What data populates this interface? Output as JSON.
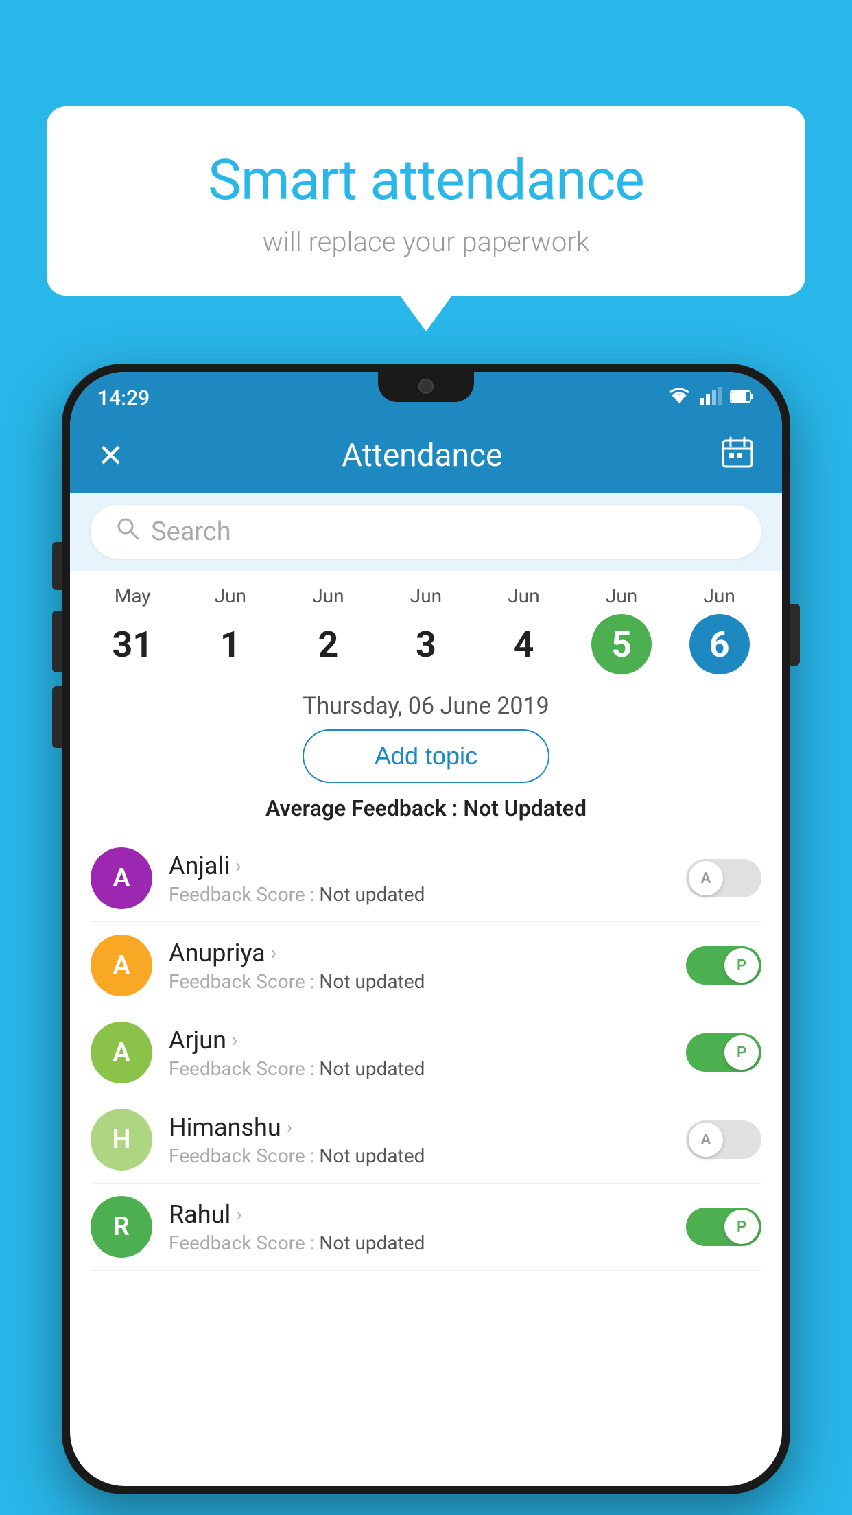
{
  "bubble": {
    "title": "Smart attendance",
    "subtitle": "will replace your paperwork"
  },
  "statusBar": {
    "time": "14:29",
    "wifi": "▼",
    "signal": "▲",
    "battery": "▐"
  },
  "header": {
    "title": "Attendance",
    "closeLabel": "✕",
    "calendarLabel": "📅"
  },
  "search": {
    "placeholder": "Search"
  },
  "calendar": {
    "days": [
      {
        "month": "May",
        "num": "31",
        "state": "normal"
      },
      {
        "month": "Jun",
        "num": "1",
        "state": "normal"
      },
      {
        "month": "Jun",
        "num": "2",
        "state": "normal"
      },
      {
        "month": "Jun",
        "num": "3",
        "state": "normal"
      },
      {
        "month": "Jun",
        "num": "4",
        "state": "normal"
      },
      {
        "month": "Jun",
        "num": "5",
        "state": "today"
      },
      {
        "month": "Jun",
        "num": "6",
        "state": "selected"
      }
    ],
    "selectedDate": "Thursday, 06 June 2019"
  },
  "addTopic": {
    "label": "Add topic"
  },
  "averageFeedback": {
    "label": "Average Feedback : ",
    "value": "Not Updated"
  },
  "students": [
    {
      "name": "Anjali",
      "avatarLetter": "A",
      "avatarColor": "#9c27b0",
      "feedbackLabel": "Feedback Score : ",
      "feedbackValue": "Not updated",
      "toggleState": "off",
      "toggleLetter": "A"
    },
    {
      "name": "Anupriya",
      "avatarLetter": "A",
      "avatarColor": "#f9a825",
      "feedbackLabel": "Feedback Score : ",
      "feedbackValue": "Not updated",
      "toggleState": "on",
      "toggleLetter": "P"
    },
    {
      "name": "Arjun",
      "avatarLetter": "A",
      "avatarColor": "#8bc34a",
      "feedbackLabel": "Feedback Score : ",
      "feedbackValue": "Not updated",
      "toggleState": "on",
      "toggleLetter": "P"
    },
    {
      "name": "Himanshu",
      "avatarLetter": "H",
      "avatarColor": "#aed581",
      "feedbackLabel": "Feedback Score : ",
      "feedbackValue": "Not updated",
      "toggleState": "off",
      "toggleLetter": "A"
    },
    {
      "name": "Rahul",
      "avatarLetter": "R",
      "avatarColor": "#4caf50",
      "feedbackLabel": "Feedback Score : ",
      "feedbackValue": "Not updated",
      "toggleState": "on",
      "toggleLetter": "P"
    }
  ]
}
